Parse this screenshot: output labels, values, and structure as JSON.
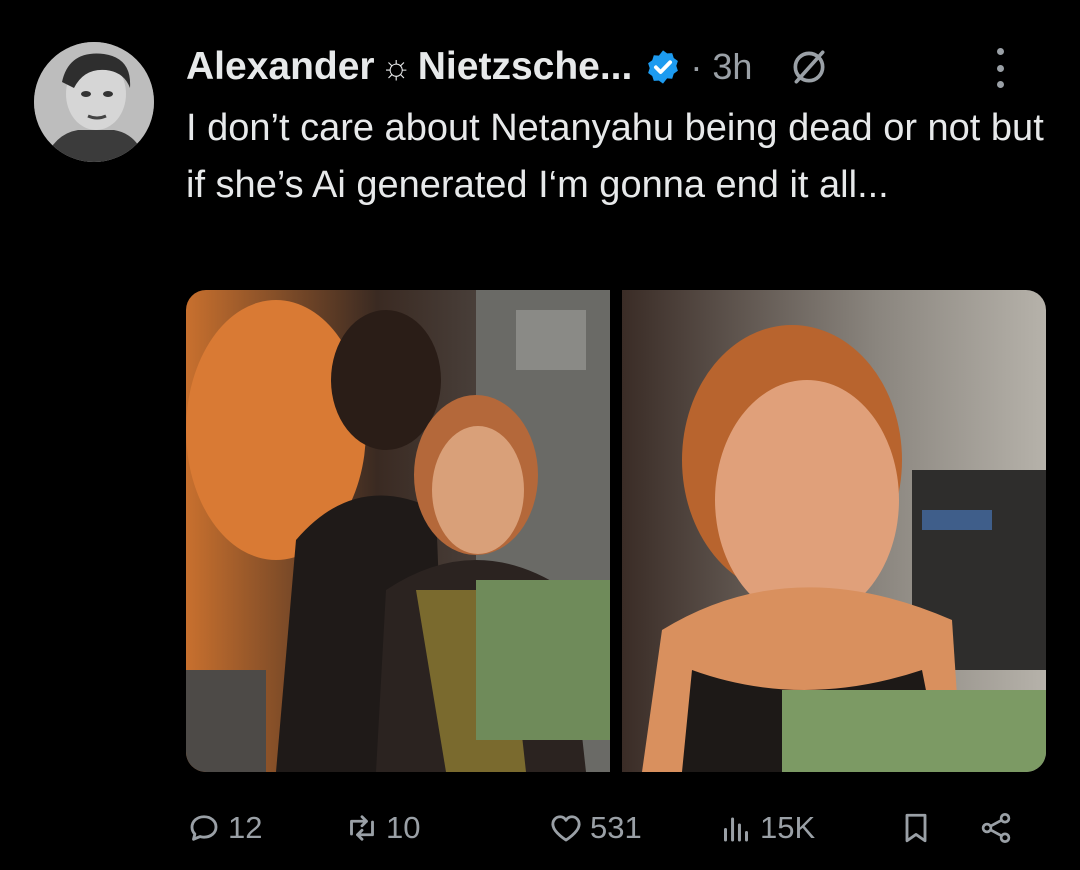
{
  "author": {
    "name_first": "Alexander",
    "name_symbol": "☼",
    "name_rest": "Nietzsche...",
    "verified_icon": "verified-badge-icon",
    "timestamp": "· 3h"
  },
  "tweet": {
    "text": "I don’t care about Netanyahu being dead or not but if she’s Ai generated I‘m gonna end it all..."
  },
  "actions": {
    "replies": "12",
    "reposts": "10",
    "likes": "531",
    "views": "15K"
  },
  "colors": {
    "background": "#000000",
    "text": "#e7e9ea",
    "muted": "#9aa0a6",
    "verified": "#1d9bf0"
  }
}
